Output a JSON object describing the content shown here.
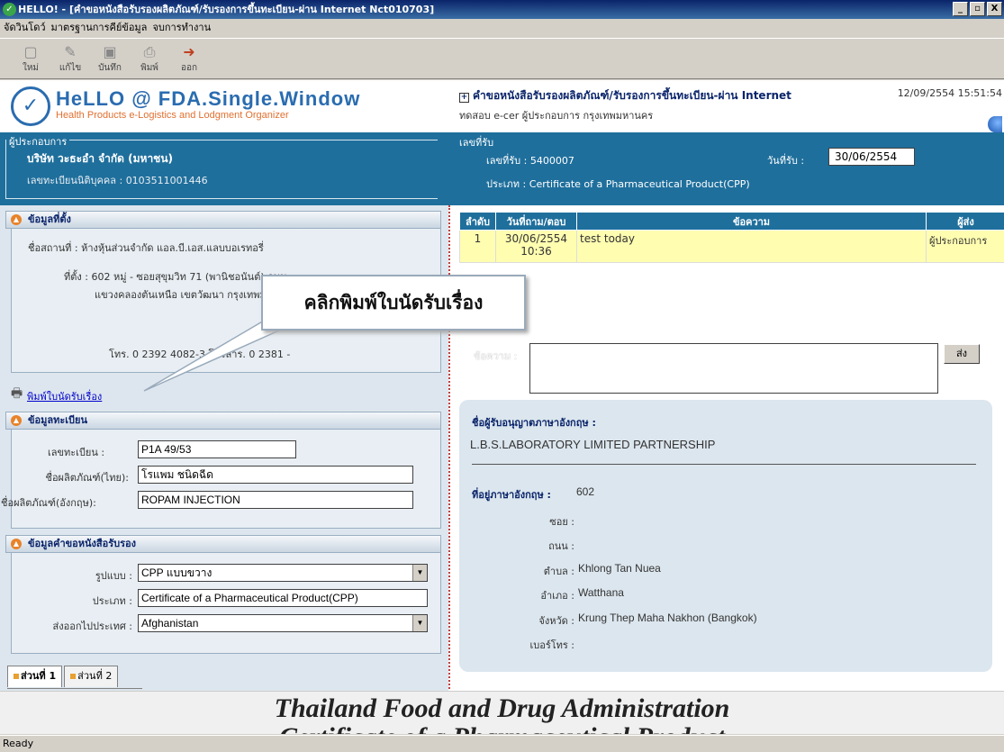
{
  "window": {
    "title": "HELLO! - [คำขอหนังสือรับรองผลิตภัณฑ์/รับรองการขึ้นทะเบียน-ผ่าน Internet  Nct010703]",
    "controls": [
      "_",
      "▫",
      "X"
    ]
  },
  "menu": [
    "จัดวินโดว์",
    "มาตรฐานการคีย์ข้อมูล",
    "จบการทำงาน"
  ],
  "toolbar": [
    {
      "label": "ใหม่",
      "icon": "new-document-icon"
    },
    {
      "label": "แก้ไข",
      "icon": "edit-icon"
    },
    {
      "label": "บันทึก",
      "icon": "save-icon"
    },
    {
      "label": "พิมพ์",
      "icon": "print-icon"
    },
    {
      "label": "ออก",
      "icon": "exit-icon"
    }
  ],
  "header": {
    "logo_title": "HeLLO @ FDA.Single.Window",
    "logo_subtitle": "Health Products e-Logistics and Lodgment Organizer",
    "form_title": "คำขอหนังสือรับรองผลิตภัณฑ์/รับรองการขึ้นทะเบียน-ผ่าน Internet",
    "form_subtitle": "ทดสอบ e-cer ผู้ประกอบการ  กรุงเทพมหานคร",
    "datetime": "12/09/2554 15:51:54"
  },
  "operator": {
    "legend": "ผู้ประกอบการ",
    "company": "บริษัท วะธะอำ จำกัด (มหาชน)",
    "company_id": "เลขทะเบียนนิติบุคคล : 0103511001446"
  },
  "receipt": {
    "legend": "เลขที่รับ",
    "number": "เลขที่รับ :  5400007",
    "date_label": "วันที่รับ :",
    "date": "30/06/2554",
    "type": "ประเภท :  Certificate of a Pharmaceutical Product(CPP)"
  },
  "location": {
    "heading": "ข้อมูลที่ตั้ง",
    "place": "ชื่อสถานที่ : ห้างหุ้นส่วนจำกัด แอล.บี.เอส.แลบบอเรทอรี่",
    "address1": "ที่ตั้ง : 602 หมู่ - ซอยสุขุมวิท 71 (พานิชอนันต์) ถนน -",
    "address2": "แขวงคลองตันเหนือ เขตวัฒนา กรุงเทพมหานคร",
    "phone": "โทร. 0 2392 4082-3 โทรสาร. 0 2381 -",
    "print_link": "พิมพ์ใบนัดรับเรื่อง"
  },
  "registration": {
    "heading": "ข้อมูลทะเบียน",
    "reg_no_label": "เลขทะเบียน :",
    "reg_no": "P1A 49/53",
    "name_th_label": "ชื่อผลิตภัณฑ์(ไทย):",
    "name_th": "โรแพม ชนิดฉีด",
    "name_en_label": "ชื่อผลิตภัณฑ์(อังกฤษ):",
    "name_en": "ROPAM INJECTION"
  },
  "request": {
    "heading": "ข้อมูลคำขอหนังสือรับรอง",
    "format_label": "รูปแบบ :",
    "format": "CPP แบบขวาง",
    "type_label": "ประเภท :",
    "type": "Certificate of a Pharmaceutical Product(CPP)",
    "country_label": "ส่งออกไปประเทศ :",
    "country": "Afghanistan"
  },
  "messages": {
    "columns": [
      "ลำดับ",
      "วันที่ถาม/ตอบ",
      "ข้อความ",
      "ผู้ส่ง"
    ],
    "rows": [
      {
        "seq": "1",
        "date": "30/06/2554 10:36",
        "text": "test today",
        "sender": "ผู้ประกอบการ"
      }
    ],
    "input_label": "ข้อความ :",
    "send_label": "ส่ง"
  },
  "licensee": {
    "name_label": "ชื่อผู้รับอนุญาตภาษาอังกฤษ :",
    "name": "L.B.S.LABORATORY LIMITED PARTNERSHIP",
    "address_label": "ที่อยู่ภาษาอังกฤษ :",
    "address": "602",
    "soi_label": "ซอย :",
    "road_label": "ถนน :",
    "subdistrict_label": "ตำบล :",
    "subdistrict": "Khlong Tan Nuea",
    "district_label": "อำเภอ :",
    "district": "Watthana",
    "province_label": "จังหวัด :",
    "province": "Krung Thep Maha Nakhon (Bangkok)",
    "phone_label": "เบอร์โทร :"
  },
  "tabs": [
    "ส่วนที่ 1",
    "ส่วนที่ 2"
  ],
  "footer": {
    "line1": "Thailand Food and Drug Administration",
    "line2": "Certificate of a Pharmaceutical Product"
  },
  "callout": "คลิกพิมพ์ใบนัดรับเรื่อง",
  "status": "Ready"
}
